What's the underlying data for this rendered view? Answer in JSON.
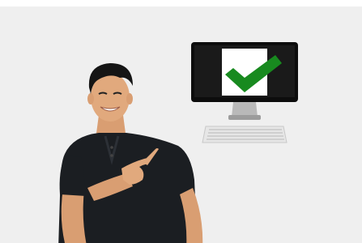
{
  "scene": {
    "background_color": "#efefef",
    "person": {
      "shirt_color": "#1b1e22",
      "skin_color": "#e1a97d",
      "hair_color": "#151515"
    },
    "computer": {
      "monitor_color": "#0d0d0d",
      "screen_color": "#ffffff",
      "checkmark_color": "#188a1f",
      "keyboard_color": "#e6e6e6"
    }
  }
}
